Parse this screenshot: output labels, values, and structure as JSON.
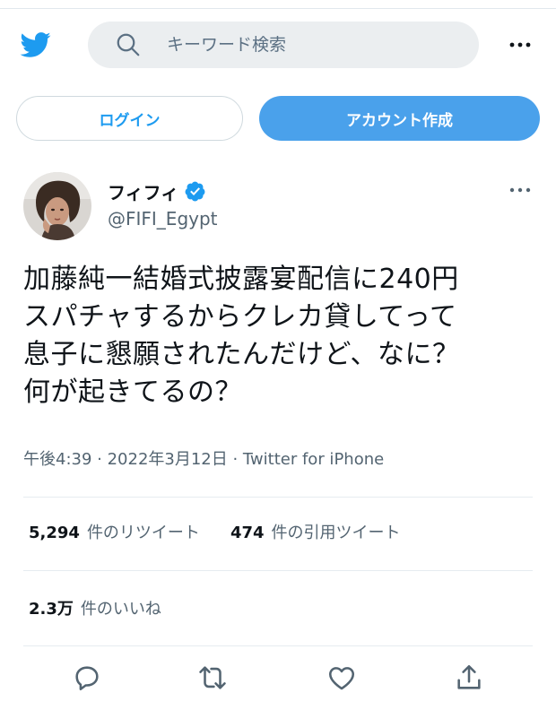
{
  "header": {
    "logo_icon": "twitter-bird-icon",
    "search_placeholder": "キーワード検索",
    "more_icon": "more-horizontal-icon"
  },
  "auth": {
    "login_label": "ログイン",
    "signup_label": "アカウント作成"
  },
  "tweet": {
    "display_name": "フィフィ",
    "handle": "@FIFI_Egypt",
    "verified": true,
    "text_lines": [
      "加藤純一結婚式披露宴配信に240円",
      "スパチャするからクレカ貸してって",
      "息子に懇願されたんだけど、なに？",
      "何が起きてるの？"
    ],
    "meta": "午後4:39 · 2022年3月12日 · Twitter for iPhone"
  },
  "stats": {
    "retweets_count": "5,294",
    "retweets_label": "件のリツイート",
    "quotes_count": "474",
    "quotes_label": "件の引用ツイート",
    "likes_count": "2.3万",
    "likes_label": "件のいいね"
  },
  "actions": [
    "reply-icon",
    "retweet-icon",
    "like-icon",
    "share-icon"
  ],
  "colors": {
    "brand": "#1d9bf0",
    "signup_bg": "#4aa1eb",
    "search_bg": "#ebeef0",
    "secondary_text": "#536471"
  }
}
